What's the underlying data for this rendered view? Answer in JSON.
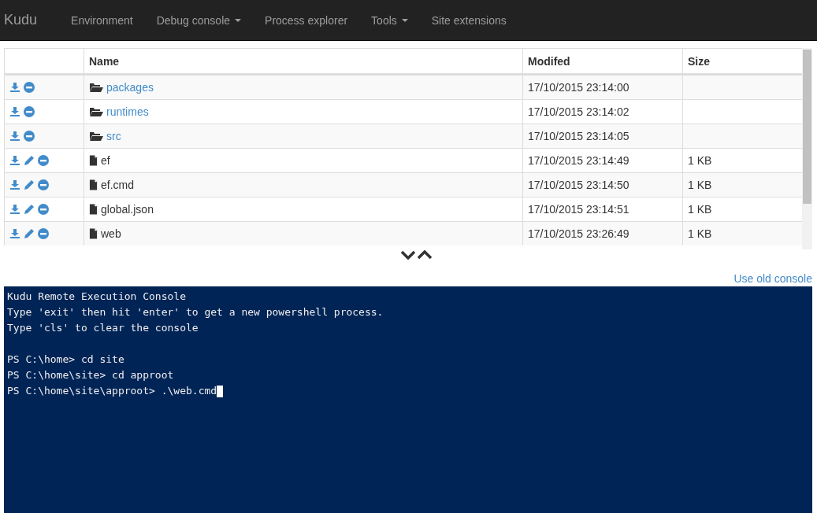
{
  "navbar": {
    "brand": "Kudu",
    "items": [
      {
        "label": "Environment",
        "dropdown": false
      },
      {
        "label": "Debug console",
        "dropdown": true
      },
      {
        "label": "Process explorer",
        "dropdown": false
      },
      {
        "label": "Tools",
        "dropdown": true
      },
      {
        "label": "Site extensions",
        "dropdown": false
      }
    ]
  },
  "file_table": {
    "columns": [
      "Name",
      "Modifed",
      "Size"
    ],
    "rows": [
      {
        "kind": "folder",
        "name": "packages",
        "modified": "17/10/2015 23:14:00"
      },
      {
        "kind": "folder",
        "name": "runtimes",
        "modified": "17/10/2015 23:14:02"
      },
      {
        "kind": "folder",
        "name": "src",
        "modified": "17/10/2015 23:14:05"
      },
      {
        "kind": "file",
        "name": "ef",
        "modified": "17/10/2015 23:14:49",
        "size": "1 KB"
      },
      {
        "kind": "file",
        "name": "ef.cmd",
        "modified": "17/10/2015 23:14:50",
        "size": "1 KB"
      },
      {
        "kind": "file",
        "name": "global.json",
        "modified": "17/10/2015 23:14:51",
        "size": "1 KB"
      },
      {
        "kind": "file",
        "name": "web",
        "modified": "17/10/2015 23:26:49",
        "size": "1 KB"
      }
    ]
  },
  "old_console_link": "Use old console",
  "console": {
    "banner": [
      "Kudu Remote Execution Console",
      "Type 'exit' then hit 'enter' to get a new powershell process.",
      "Type 'cls' to clear the console"
    ],
    "history": [
      "PS C:\\home> cd site",
      "PS C:\\home\\site> cd approot",
      "PS C:\\home\\site\\approot> .\\web.cmd"
    ],
    "cursor": true
  }
}
